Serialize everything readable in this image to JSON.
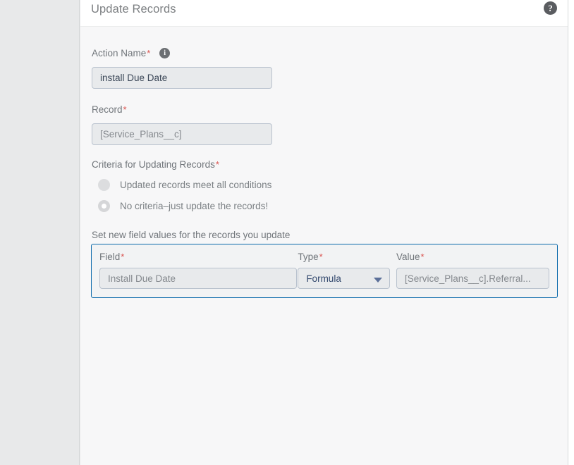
{
  "window": {
    "title": "Update Records",
    "help_icon": "help-circle-icon",
    "accent_blue": "#0b6aab",
    "required_marker": "*"
  },
  "form": {
    "action_name": {
      "label": "Action Name",
      "required": "*",
      "info_icon": "info-circle-icon",
      "value": "install Due Date"
    },
    "record": {
      "label": "Record",
      "required": "*",
      "value": "[Service_Plans__c]"
    },
    "criteria": {
      "label": "Criteria for Updating Records",
      "required": "*",
      "options": [
        {
          "label": "Updated records meet all conditions",
          "selected": false
        },
        {
          "label": "No criteria–just update the records!",
          "selected": true
        }
      ]
    },
    "field_values": {
      "section_label": "Set new field values for the records you update",
      "columns": {
        "field": {
          "label": "Field",
          "required": "*",
          "value": "Install Due Date"
        },
        "type": {
          "label": "Type",
          "required": "*",
          "value": "Formula",
          "caret_icon": "chevron-down-icon"
        },
        "value": {
          "label": "Value",
          "required": "*",
          "value": "[Service_Plans__c].Referral..."
        }
      }
    }
  }
}
